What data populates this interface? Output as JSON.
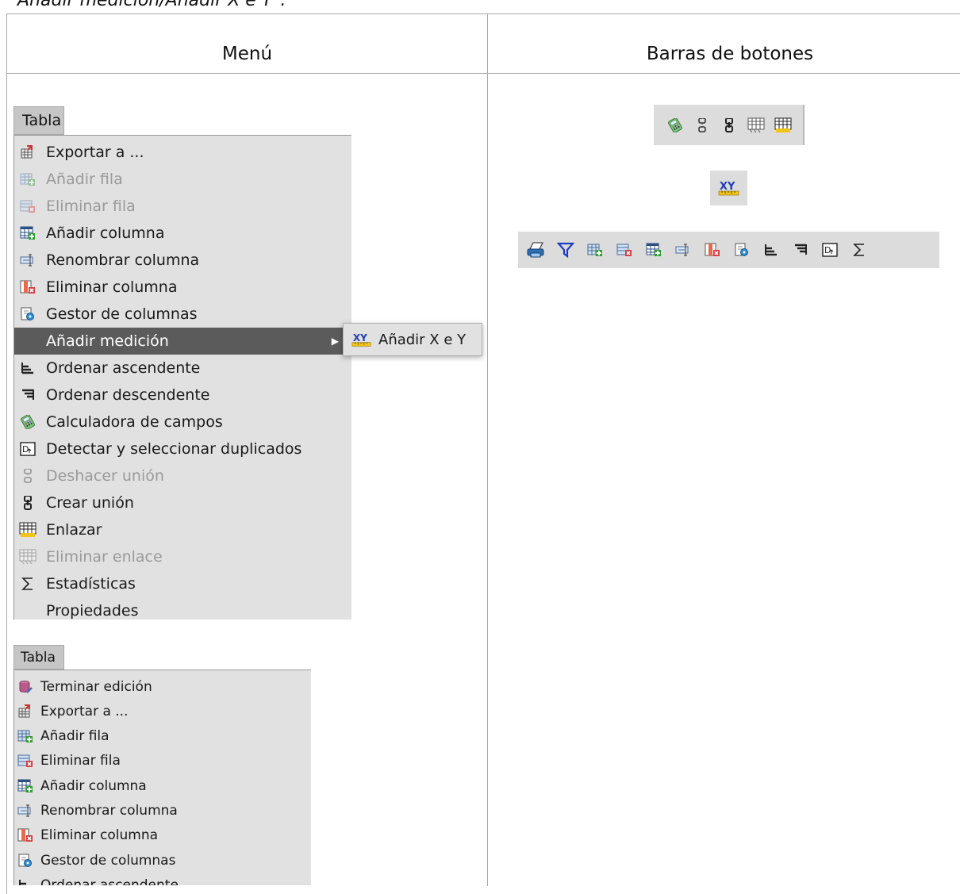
{
  "caption": "Añadir medición/Añadir X e Y\".",
  "table": {
    "col_menu": "Menú",
    "col_bars": "Barras de botones"
  },
  "menu_top": {
    "title": "Tabla",
    "items": [
      {
        "label": "Exportar a ...",
        "icon": "export-icon",
        "state": "enabled"
      },
      {
        "label": "Añadir fila",
        "icon": "add-row-icon",
        "state": "disabled"
      },
      {
        "label": "Eliminar fila",
        "icon": "delete-row-icon",
        "state": "disabled"
      },
      {
        "label": "Añadir columna",
        "icon": "add-column-icon",
        "state": "enabled"
      },
      {
        "label": "Renombrar columna",
        "icon": "rename-column-icon",
        "state": "enabled"
      },
      {
        "label": "Eliminar columna",
        "icon": "delete-column-icon",
        "state": "enabled"
      },
      {
        "label": "Gestor de columnas",
        "icon": "column-manager-icon",
        "state": "enabled"
      },
      {
        "label": "Añadir medición",
        "icon": "",
        "state": "highlighted"
      },
      {
        "label": "Ordenar ascendente",
        "icon": "sort-ascending-icon",
        "state": "enabled"
      },
      {
        "label": "Ordenar descendente",
        "icon": "sort-descending-icon",
        "state": "enabled"
      },
      {
        "label": "Calculadora de campos",
        "icon": "calculator-icon",
        "state": "enabled"
      },
      {
        "label": "Detectar y seleccionar duplicados",
        "icon": "duplicates-icon",
        "state": "enabled"
      },
      {
        "label": "Deshacer unión",
        "icon": "unjoin-icon",
        "state": "disabled"
      },
      {
        "label": "Crear unión",
        "icon": "join-icon",
        "state": "enabled"
      },
      {
        "label": "Enlazar",
        "icon": "link-icon",
        "state": "enabled"
      },
      {
        "label": "Eliminar enlace",
        "icon": "unlink-icon",
        "state": "disabled"
      },
      {
        "label": "Estadísticas",
        "icon": "sigma-icon",
        "state": "enabled"
      },
      {
        "label": "Propiedades",
        "icon": "",
        "state": "enabled"
      }
    ],
    "submenu": {
      "label": "Añadir X e Y",
      "icon": "xy-icon"
    }
  },
  "menu_bottom": {
    "title": "Tabla",
    "items": [
      {
        "label": "Terminar edición",
        "icon": "stop-edit-icon"
      },
      {
        "label": "Exportar a ...",
        "icon": "export-icon"
      },
      {
        "label": "Añadir fila",
        "icon": "add-row-icon"
      },
      {
        "label": "Eliminar fila",
        "icon": "delete-row-icon"
      },
      {
        "label": "Añadir columna",
        "icon": "add-column-icon"
      },
      {
        "label": "Renombrar columna",
        "icon": "rename-column-icon"
      },
      {
        "label": "Eliminar columna",
        "icon": "delete-column-icon"
      },
      {
        "label": "Gestor de columnas",
        "icon": "column-manager-icon"
      },
      {
        "label": "Ordenar ascendente",
        "icon": "sort-ascending-icon"
      }
    ]
  },
  "toolbars": {
    "bar1": [
      "calculator-icon",
      "unjoin-icon",
      "join-icon",
      "unlink-icon",
      "link-icon"
    ],
    "bar2": [
      "xy-icon"
    ],
    "bar3": [
      "print-icon",
      "filter-icon",
      "add-row-icon",
      "delete-row-icon",
      "add-column-icon",
      "rename-column-icon",
      "delete-column-icon",
      "column-manager-icon",
      "sort-ascending-icon",
      "sort-descending-icon",
      "duplicates-icon",
      "sigma-icon"
    ]
  },
  "colors": {
    "menu_bg": "#e1e1e1",
    "highlight": "#5b5b5b",
    "toolbar_bg": "#dcdcdc"
  }
}
